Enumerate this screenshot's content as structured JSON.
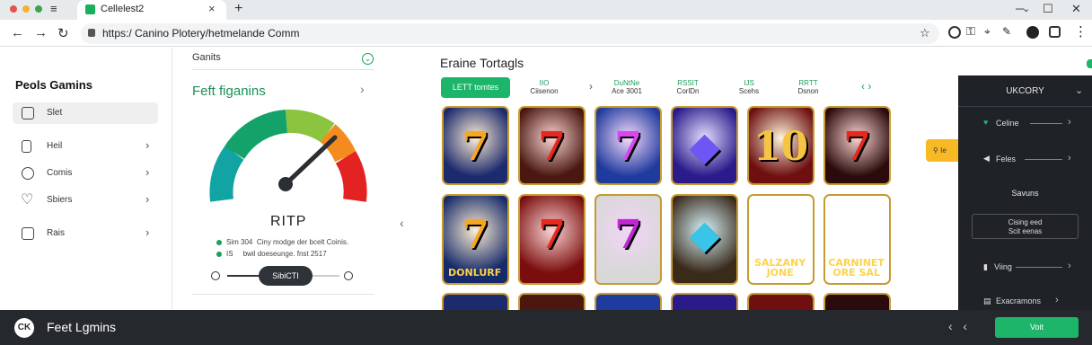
{
  "browser": {
    "tab_title": "Cellelest2",
    "url": "https:/ Canino Plotery/hetmelande Comm"
  },
  "sidebar": {
    "title": "Peols Gamins",
    "items": [
      {
        "label": "Slet",
        "icon": "hand-icon"
      },
      {
        "label": "Heil",
        "icon": "phone-icon"
      },
      {
        "label": "Comis",
        "icon": "clock-icon"
      },
      {
        "label": "Sbiers",
        "icon": "heart-icon"
      },
      {
        "label": "Rais",
        "icon": "book-icon"
      }
    ]
  },
  "gauge_panel": {
    "top_label": "Ganits",
    "title": "Feft figanins",
    "gauge_label": "RITP",
    "stats": [
      {
        "k": "Sim 304",
        "v": "Ciny modge der bcelt Coinis."
      },
      {
        "k": "IS",
        "v": "bwil doeseunge. fnst 2517"
      }
    ],
    "button": "SibiCTI"
  },
  "center": {
    "title": "Eraine Tortagls",
    "pill": "LETT tomtes",
    "categories": [
      {
        "l1": "IIO",
        "l2": "Ciisenon"
      },
      {
        "l1": "DuNtNe",
        "l2": "Ace 3001"
      },
      {
        "l1": "RSSIT",
        "l2": "CorlDn"
      },
      {
        "l1": "IJS",
        "l2": "Scehs"
      },
      {
        "l1": "RRTT",
        "l2": "Dsnon"
      }
    ],
    "row1": [
      {
        "n": "7",
        "bg": "#1c2a6e",
        "fg": "#f5a623"
      },
      {
        "n": "7",
        "bg": "#4a1810",
        "fg": "#e8271f"
      },
      {
        "n": "7",
        "bg": "#1f3b9e",
        "fg": "#d946ef"
      },
      {
        "n": "◆",
        "bg": "#2a1a8a",
        "fg": "#6e56f5"
      },
      {
        "n": "10",
        "bg": "#6e0f10",
        "fg": "#f5c542"
      },
      {
        "n": "7",
        "bg": "#2a0a0a",
        "fg": "#e8271f"
      }
    ],
    "row2": [
      {
        "n": "7",
        "w": "DONLURF",
        "bg": "#152a6a",
        "fg": "#f5a623"
      },
      {
        "n": "7",
        "w": "",
        "bg": "#7a0d0d",
        "fg": "#e8271f"
      },
      {
        "n": "7",
        "w": "",
        "bg": "#d8d8d8",
        "fg": "#c026d3"
      },
      {
        "n": "◆",
        "w": "",
        "bg": "#3a2a1a",
        "fg": "#39c5e8"
      },
      {
        "n": "",
        "w": "SALZANY JONE",
        "bg": "#2a7a6a",
        "fg": "#fff"
      },
      {
        "n": "",
        "w": "CARNINET ORE SAL",
        "bg": "#8fd0f0",
        "fg": "#fff"
      }
    ]
  },
  "drawer": {
    "title": "UKCORY",
    "items": [
      {
        "label": "Celine"
      },
      {
        "label": "Feles"
      }
    ],
    "section": "Savuns",
    "box_line1": "Cising eed",
    "box_line2": "Scit eenas",
    "items2": [
      {
        "label": "Viing"
      },
      {
        "label": "Exacramons"
      }
    ],
    "side_button": "Ie"
  },
  "bottom": {
    "logo": "CK",
    "title": "Feet Lgmins",
    "button": "Voit"
  },
  "colors": {
    "accent": "#1db56a",
    "dark": "#25292e"
  }
}
